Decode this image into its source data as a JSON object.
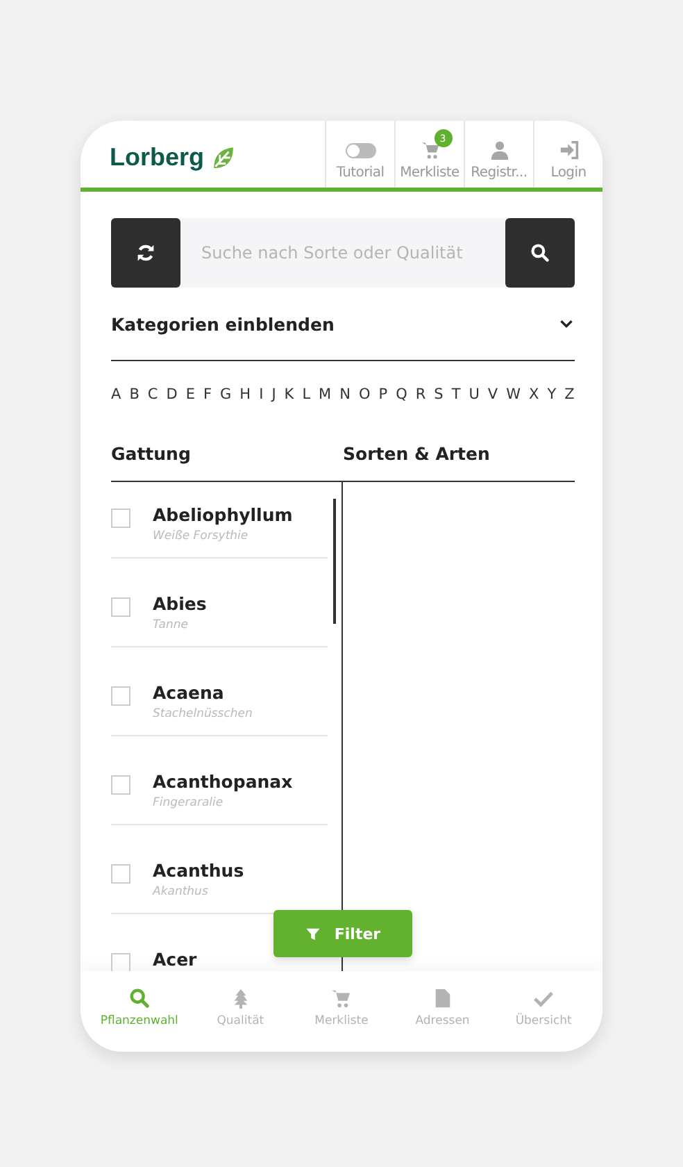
{
  "brand": {
    "name": "Lorberg"
  },
  "header_actions": [
    {
      "kind": "toggle",
      "label": "Tutorial",
      "on": false
    },
    {
      "kind": "cart",
      "label": "Merkliste",
      "badge": "3"
    },
    {
      "kind": "user",
      "label": "Registr..."
    },
    {
      "kind": "login",
      "label": "Login"
    }
  ],
  "search": {
    "placeholder": "Suche nach Sorte oder Qualität"
  },
  "categories": {
    "label": "Kategorien einblenden",
    "expanded": false
  },
  "alphabet": [
    "A",
    "B",
    "C",
    "D",
    "E",
    "F",
    "G",
    "H",
    "I",
    "J",
    "K",
    "L",
    "M",
    "N",
    "O",
    "P",
    "Q",
    "R",
    "S",
    "T",
    "U",
    "V",
    "W",
    "X",
    "Y",
    "Z"
  ],
  "columns": [
    "Gattung",
    "Sorten & Arten"
  ],
  "genera": [
    {
      "name": "Abeliophyllum",
      "common": "Weiße Forsythie",
      "checked": false
    },
    {
      "name": "Abies",
      "common": "Tanne",
      "checked": false
    },
    {
      "name": "Acaena",
      "common": "Stachelnüsschen",
      "checked": false
    },
    {
      "name": "Acanthopanax",
      "common": "Fingeraralie",
      "checked": false
    },
    {
      "name": "Acanthus",
      "common": "Akanthus",
      "checked": false
    },
    {
      "name": "Acer",
      "checked": false
    }
  ],
  "filter_button": {
    "label": "Filter"
  },
  "bottom_nav": [
    {
      "kind": "search",
      "label": "Pflanzenwahl",
      "selected": true
    },
    {
      "kind": "tree",
      "label": "Qualität",
      "selected": false
    },
    {
      "kind": "cart",
      "label": "Merkliste",
      "selected": false
    },
    {
      "kind": "document",
      "label": "Adressen",
      "selected": false
    },
    {
      "kind": "check",
      "label": "Übersicht",
      "selected": false
    }
  ]
}
